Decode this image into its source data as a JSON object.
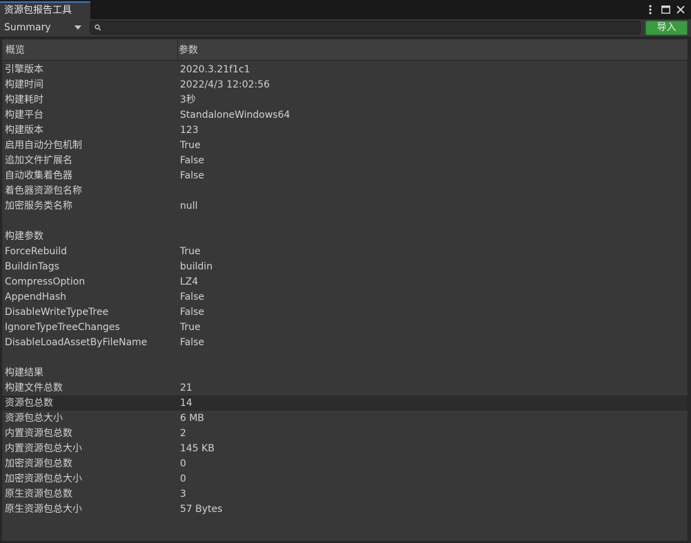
{
  "window": {
    "tab_title": "资源包报告工具"
  },
  "toolbar": {
    "view_selected": "Summary",
    "search_value": "",
    "import_label": "导入"
  },
  "table": {
    "headers": [
      "概览",
      "参数"
    ],
    "rows": [
      {
        "key": "引擎版本",
        "value": "2020.3.21f1c1"
      },
      {
        "key": "构建时间",
        "value": "2022/4/3 12:02:56"
      },
      {
        "key": "构建耗时",
        "value": "3秒"
      },
      {
        "key": "构建平台",
        "value": "StandaloneWindows64"
      },
      {
        "key": "构建版本",
        "value": "123"
      },
      {
        "key": "启用自动分包机制",
        "value": "True"
      },
      {
        "key": "追加文件扩展名",
        "value": "False"
      },
      {
        "key": "自动收集着色器",
        "value": "False"
      },
      {
        "key": "着色器资源包名称",
        "value": ""
      },
      {
        "key": "加密服务类名称",
        "value": "null"
      },
      {
        "key": "",
        "value": ""
      },
      {
        "key": "构建参数",
        "value": ""
      },
      {
        "key": "ForceRebuild",
        "value": "True"
      },
      {
        "key": "BuildinTags",
        "value": "buildin"
      },
      {
        "key": "CompressOption",
        "value": "LZ4"
      },
      {
        "key": "AppendHash",
        "value": "False"
      },
      {
        "key": "DisableWriteTypeTree",
        "value": "False"
      },
      {
        "key": "IgnoreTypeTreeChanges",
        "value": "True"
      },
      {
        "key": "DisableLoadAssetByFileName",
        "value": "False"
      },
      {
        "key": "",
        "value": ""
      },
      {
        "key": "构建结果",
        "value": ""
      },
      {
        "key": "构建文件总数",
        "value": "21"
      },
      {
        "key": "资源包总数",
        "value": "14",
        "selected": true
      },
      {
        "key": "资源包总大小",
        "value": "6 MB"
      },
      {
        "key": "内置资源包总数",
        "value": "2"
      },
      {
        "key": "内置资源包总大小",
        "value": "145 KB"
      },
      {
        "key": "加密资源包总数",
        "value": "0"
      },
      {
        "key": "加密资源包总大小",
        "value": "0"
      },
      {
        "key": "原生资源包总数",
        "value": "3"
      },
      {
        "key": "原生资源包总大小",
        "value": "57 Bytes"
      }
    ]
  },
  "icons": {
    "menu": "kebab-menu-icon",
    "maximize": "maximize-icon",
    "close": "close-icon",
    "search": "search-icon",
    "dropdown": "chevron-down-icon"
  },
  "colors": {
    "accent_tab": "#3a79bb",
    "import_button": "#3a9b3f"
  }
}
